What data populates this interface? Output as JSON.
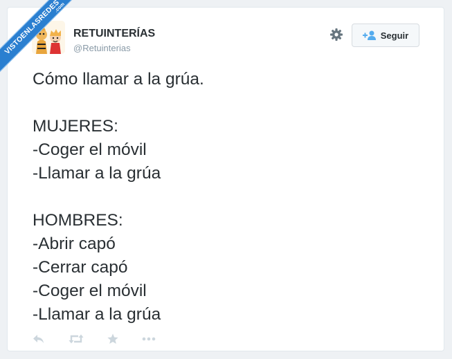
{
  "watermark": {
    "text": "VISTOENLASREDES",
    "suffix": ".com"
  },
  "tweet": {
    "author_name": "RETUINTERÍAS",
    "author_handle": "@Retuinterias",
    "follow_label": "Seguir",
    "text": "Cómo llamar a la grúa.\n\nMUJERES:\n-Coger el móvil\n-Llamar a la grúa\n\nHOMBRES:\n-Abrir capó\n-Cerrar capó\n-Coger el móvil\n-Llamar a la grúa"
  },
  "icons": {
    "gear": "gear-icon",
    "follow": "add-user-icon",
    "reply": "reply-icon",
    "retweet": "retweet-icon",
    "favorite": "star-icon",
    "more": "more-icon"
  },
  "colors": {
    "text": "#292f33",
    "muted": "#8899a6",
    "action_icons": "#ccd6dd",
    "follow_icon": "#55acee",
    "ribbon": "#2a7fd0"
  }
}
